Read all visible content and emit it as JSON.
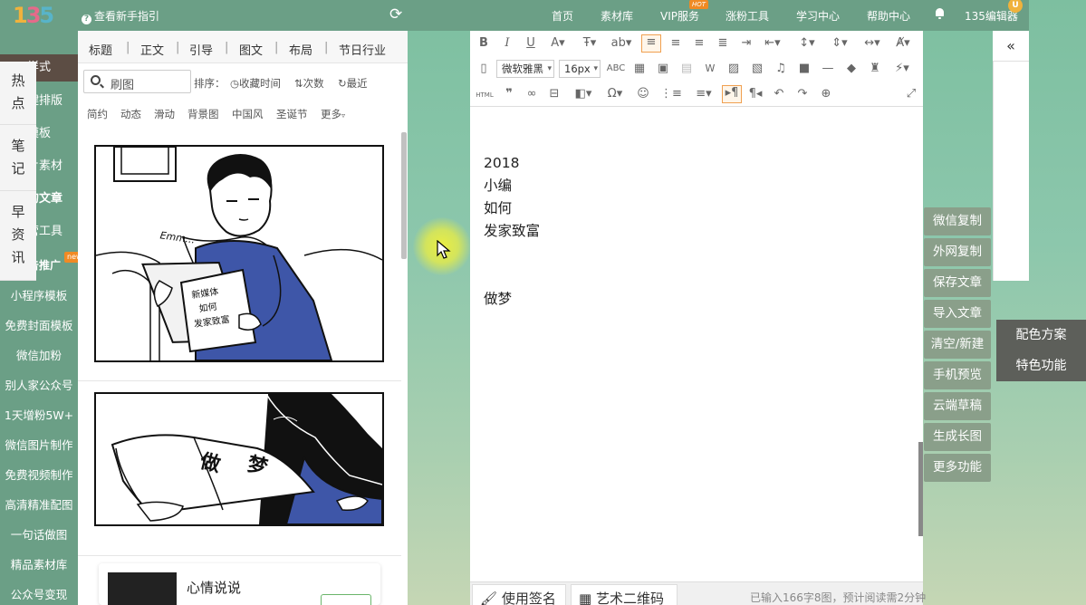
{
  "app": {
    "logo": "135",
    "guide_link": "查看新手指引",
    "refresh_icon": "refresh-icon"
  },
  "topnav": {
    "items": [
      "首页",
      "素材库",
      "VIP服务",
      "涨粉工具",
      "学习中心",
      "帮助中心"
    ],
    "hot_badge": "HOT",
    "user": "135编辑器",
    "avatar_badge": "U"
  },
  "leftnav": {
    "items": [
      "样式",
      "一键排版",
      "模板",
      "图片素材",
      "我的文章",
      "运营工具",
      "广告推广",
      "小程序模板",
      "免费封面模板",
      "微信加粉",
      "别人家公众号",
      "1天增粉5W+",
      "微信图片制作",
      "免费视频制作",
      "高清精准配图",
      "一句话做图",
      "精品素材库",
      "公众号变现"
    ],
    "new_badge": "new"
  },
  "library": {
    "categories": [
      "标题",
      "正文",
      "引导",
      "图文",
      "布局",
      "节日行业"
    ],
    "separator": "|",
    "search_placeholder": "刷图",
    "sort_label": "排序：",
    "sort_options": [
      "收藏时间",
      "次数",
      "最近"
    ],
    "tags": [
      "简约",
      "动态",
      "滑动",
      "背景图",
      "中国风",
      "圣诞节",
      "更多"
    ],
    "comic1": {
      "sound": "Emm...",
      "book_lines": [
        "新媒体",
        "如何",
        "发家致富"
      ]
    },
    "comic2": {
      "book_text": [
        "做",
        "梦"
      ]
    },
    "card3_title": "心情说说"
  },
  "editor": {
    "font_family": "微软雅黑",
    "font_size": "16px",
    "content_lines": [
      "2018",
      "小编",
      "如何",
      "发家致富",
      "",
      "",
      "做梦"
    ],
    "bottom_tabs": [
      "使用签名",
      "艺术二维码"
    ],
    "word_count": "已输入166字8图，预计阅读需2分钟"
  },
  "actions": [
    "微信复制",
    "外网复制",
    "保存文章",
    "导入文章",
    "清空/新建",
    "手机预览",
    "云端草稿",
    "生成长图",
    "更多功能"
  ],
  "right_sidebar": {
    "collapse": "«",
    "tabs": [
      "热点",
      "笔记",
      "早资讯"
    ]
  },
  "float_panel": [
    "配色方案",
    "特色功能"
  ],
  "colors": {
    "topbar": "#6b9f86",
    "active_nav": "#5c4d44",
    "hot": "#f08a24",
    "action_btn": "#8a9f8a",
    "float_panel": "#5d5f5a",
    "highlight": "#f0f03c"
  }
}
